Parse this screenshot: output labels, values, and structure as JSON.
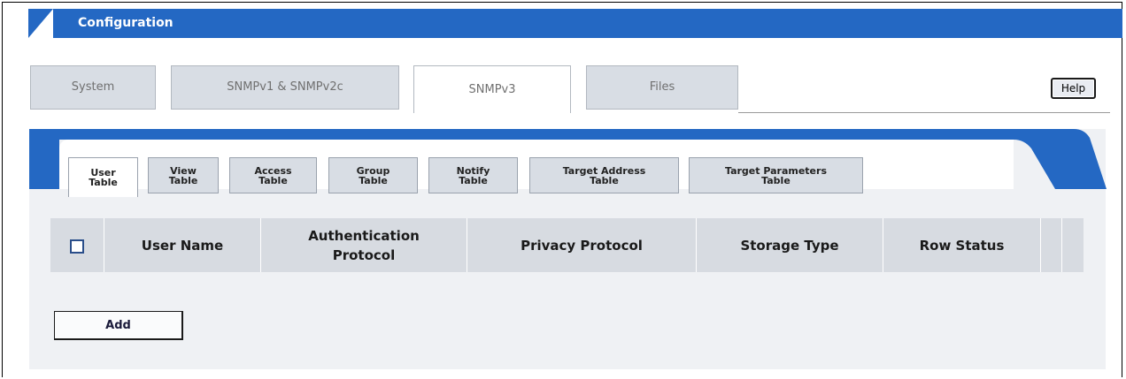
{
  "header": {
    "title": "Configuration"
  },
  "main_tabs": [
    {
      "label": "System"
    },
    {
      "label": "SNMPv1 & SNMPv2c"
    },
    {
      "label": "SNMPv3",
      "active": true
    },
    {
      "label": "Files"
    }
  ],
  "help_label": "Help",
  "sub_tabs": [
    {
      "label": "User\nTable",
      "active": true
    },
    {
      "label": "View\nTable"
    },
    {
      "label": "Access\nTable"
    },
    {
      "label": "Group\nTable"
    },
    {
      "label": "Notify\nTable"
    },
    {
      "label": "Target Address\nTable"
    },
    {
      "label": "Target Parameters\nTable"
    }
  ],
  "table": {
    "columns": [
      "User Name",
      "Authentication\nProtocol",
      "Privacy Protocol",
      "Storage Type",
      "Row Status"
    ]
  },
  "add_label": "Add",
  "colors": {
    "accent": "#2468c3",
    "tab_bg": "#d8dde4",
    "panel_bg": "#eff1f4"
  }
}
